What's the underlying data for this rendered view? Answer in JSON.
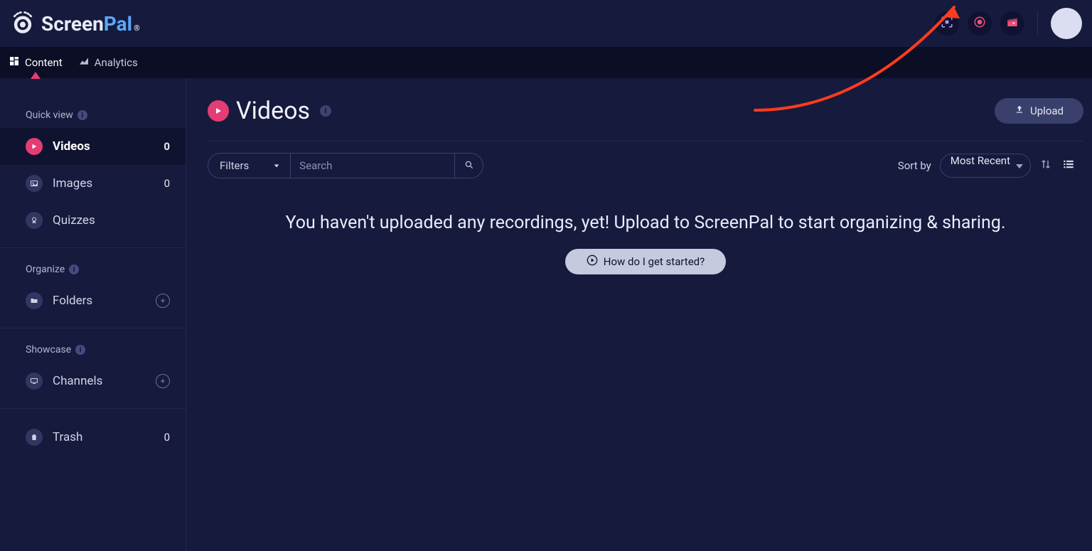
{
  "brand": {
    "screen": "Screen",
    "pal": "Pal",
    "reg": "®"
  },
  "subnav": {
    "content": "Content",
    "analytics": "Analytics"
  },
  "sidebar": {
    "quick_view": "Quick view",
    "organize": "Organize",
    "showcase": "Showcase",
    "videos": {
      "label": "Videos",
      "count": "0"
    },
    "images": {
      "label": "Images",
      "count": "0"
    },
    "quizzes": {
      "label": "Quizzes"
    },
    "folders": {
      "label": "Folders"
    },
    "channels": {
      "label": "Channels"
    },
    "trash": {
      "label": "Trash",
      "count": "0"
    }
  },
  "page": {
    "title": "Videos"
  },
  "toolbar": {
    "upload": "Upload",
    "filters": "Filters",
    "search_placeholder": "Search",
    "sort_by_label": "Sort by",
    "sort_value": "Most Recent"
  },
  "empty": {
    "message": "You haven't uploaded any recordings, yet! Upload to ScreenPal to start organizing & sharing.",
    "howto": "How do I get started?"
  }
}
